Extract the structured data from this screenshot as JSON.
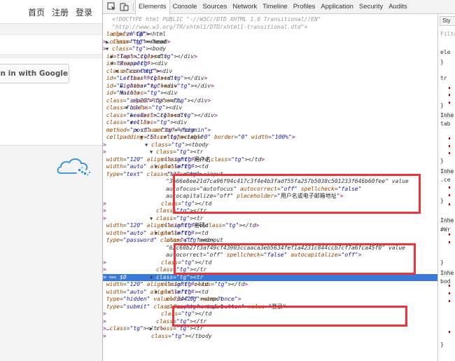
{
  "page": {
    "top_nav": [
      "首页",
      "注册",
      "登录"
    ],
    "google_button": "gn in with Google"
  },
  "devtools": {
    "tabs": [
      "Elements",
      "Console",
      "Sources",
      "Network",
      "Timeline",
      "Profiles",
      "Application",
      "Security",
      "Audits"
    ],
    "active_tab": "Elements",
    "selected_marker": "== $0",
    "styles": {
      "tab": "Sty",
      "filter": "Filte",
      "lines": [
        "ele",
        "}",
        "tr",
        "}",
        "Inhe",
        "tab",
        "}",
        "Inhe",
        ".ce",
        "}",
        "Inhe",
        "#Wr",
        "}",
        "Inhe",
        "bod",
        "}"
      ]
    },
    "dom": [
      {
        "t": "<!DOCTYPE html PUBLIC \"-//W3C//DTD XHTML 1.0 Transitional//EN\"",
        "c": "dim"
      },
      {
        "t": "\"http://www.w3.org/TR/xhtml1/DTD/xhtml1-transitional.dtd\">",
        "c": "dim"
      },
      {
        "t": "<html lang=\"zh-CN\">"
      },
      {
        "t": "<head>…</head>"
      },
      {
        "t": "<body>"
      },
      {
        "t": "<div id=\"Top\">…</div>"
      },
      {
        "t": "<div id=\"Wrapper\">"
      },
      {
        "t": "<div class=\"content\">"
      },
      {
        "t": "<div id=\"Leftbar\"></div>"
      },
      {
        "t": "<div id=\"Rightbar\">…</div>"
      },
      {
        "t": "<div id=\"Main\">"
      },
      {
        "t": "<div class=\"sep20\"></div>"
      },
      {
        "t": "<div class=\"box\">"
      },
      {
        "t": "<div class=\"header\">…</div>"
      },
      {
        "t": "<div class=\"cell\">"
      },
      {
        "t": "<form method=\"post\" action=\"/signin\">"
      },
      {
        "t": "<table cellpadding=\"5\" cellspacing=\"0\" border=\"0\" width=\"100%\">"
      },
      {
        "t": "<tbody>"
      },
      {
        "t": "<tr>"
      },
      {
        "t": "<td width=\"120\" align=\"right\">",
        "x": "用户名",
        "e": "</td>"
      },
      {
        "t": "<td width=\"auto\" align=\"left\">"
      },
      {
        "t": "<input type=\"text\" class=\"sl\" name="
      },
      {
        "t": "\"3a66e8ee21d7ca96f94c417c3f4e4b3fadf55fa257b5038c501233f646b60fee\" value"
      },
      {
        "t": "autofocus=\"autofocus\" autocorrect=\"off\" spellcheck=\"false\""
      },
      {
        "t": "autocapitalize=\"off\" placeholder=\"",
        "x": "用户名或电子邮箱地址",
        "e": "\">"
      },
      {
        "t": "</td>"
      },
      {
        "t": "</tr>"
      },
      {
        "t": "<tr>"
      },
      {
        "t": "<td width=\"120\" align=\"right\">",
        "x": "密码",
        "e": "</td>"
      },
      {
        "t": "<td width=\"auto\" align=\"left\">"
      },
      {
        "t": "<input type=\"password\" class=\"sl\" name="
      },
      {
        "t": "\"62c60b27f3af49cf43903ccaaca3eb5634fef1a4231c844ccb7cf7a6fca45f0\" value"
      },
      {
        "t": "autocorrect=\"off\" spellcheck=\"false\" autocapitalize=\"off\">"
      },
      {
        "t": "</td>"
      },
      {
        "t": "</tr>"
      },
      {
        "t": "<tr>",
        "sel": true
      },
      {
        "t": "<td width=\"120\" align=\"right\"></td>"
      },
      {
        "t": "<td width=\"auto\" align=\"left\">"
      },
      {
        "t": "<input type=\"hidden\" value=\"34427\" name=\"once\">"
      },
      {
        "t": "<input type=\"submit\" class=\"super normal button\" value=\"",
        "x": "登录",
        "e": "\">"
      },
      {
        "t": "</td>"
      },
      {
        "t": "</tr>"
      },
      {
        "t": "<tr>…</tr>"
      },
      {
        "t": "</tbody>"
      }
    ]
  }
}
